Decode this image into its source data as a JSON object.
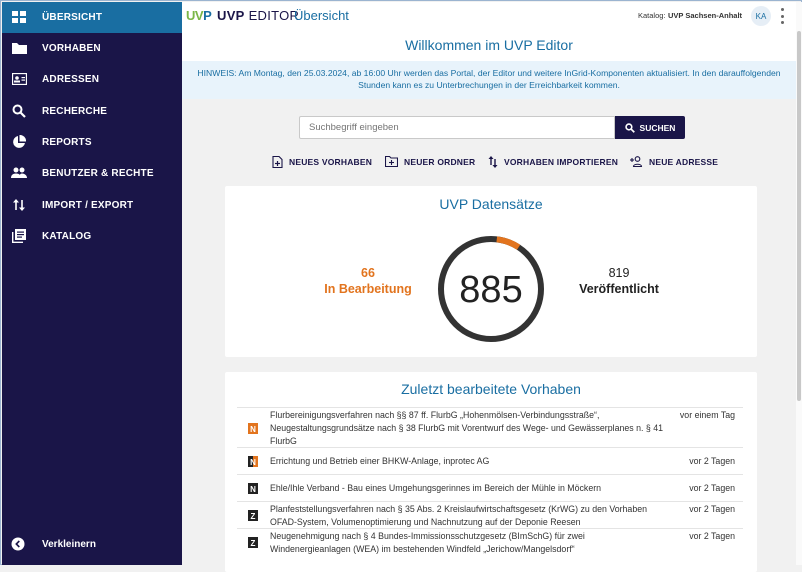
{
  "sidebar": {
    "items": [
      {
        "label": "ÜBERSICHT",
        "icon": "dashboard-icon",
        "active": true
      },
      {
        "label": "VORHABEN",
        "icon": "folder-icon"
      },
      {
        "label": "ADRESSEN",
        "icon": "contact-card-icon"
      },
      {
        "label": "RECHERCHE",
        "icon": "search-icon"
      },
      {
        "label": "REPORTS",
        "icon": "pie-chart-icon"
      },
      {
        "label": "BENUTZER & RECHTE",
        "icon": "users-icon"
      },
      {
        "label": "IMPORT / EXPORT",
        "icon": "import-export-icon"
      },
      {
        "label": "KATALOG",
        "icon": "catalog-icon"
      }
    ],
    "collapse_label": "Verkleinern"
  },
  "header": {
    "logo": "UVP",
    "app_name_bold": "UVP",
    "app_name_rest": "EDITOR",
    "page": "Übersicht",
    "catalog_label": "Katalog:",
    "catalog_value": "UVP Sachsen-Anhalt",
    "avatar": "KA"
  },
  "main": {
    "welcome": "Willkommen im UVP Editor",
    "notice": "HINWEIS: Am Montag, den 25.03.2024, ab 16:00 Uhr werden das Portal, der Editor und weitere InGrid-Komponenten aktualisiert. In den darauffolgenden Stunden kann es zu Unterbrechungen in der Erreichbarkeit kommen.",
    "search": {
      "placeholder": "Suchbegriff eingeben",
      "button": "SUCHEN"
    },
    "actions": {
      "new_project": "NEUES VORHABEN",
      "new_folder": "NEUER ORDNER",
      "import": "VORHABEN IMPORTIEREN",
      "new_address": "NEUE ADRESSE"
    },
    "stats": {
      "title": "UVP Datensätze",
      "total": "885",
      "in_progress_count": "66",
      "in_progress_label": "In Bearbeitung",
      "published_count": "819",
      "published_label": "Veröffentlicht",
      "in_progress_fraction": 0.0746,
      "colors": {
        "in_progress": "#e2741e",
        "published": "#333333"
      }
    },
    "recent": {
      "title": "Zuletzt bearbeitete Vorhaben",
      "rows": [
        {
          "text": "Flurbereinigungsverfahren nach §§ 87 ff. FlurbG „Hohenmölsen-Verbindungsstraße“, Neugestaltungsgrundsätze nach § 38 FlurbG mit Vorentwurf des Wege- und Gewässerplanes n. § 41 FlurbG",
          "time": "vor einem Tag",
          "icon": "N",
          "state": "orange"
        },
        {
          "text": "Errichtung und Betrieb einer BHKW-Anlage, inprotec AG",
          "time": "vor 2 Tagen",
          "icon": "N",
          "state": "mixed"
        },
        {
          "text": "Ehle/Ihle Verband - Bau eines Umgehungsgerinnes im Bereich der Mühle in Möckern",
          "time": "vor 2 Tagen",
          "icon": "N",
          "state": "dark"
        },
        {
          "text": "Planfeststellungsverfahren nach § 35 Abs. 2 Kreislaufwirtschaftsgesetz (KrWG) zu den Vorhaben OFAD-System, Volumenoptimierung und Nachnutzung auf der Deponie Reesen",
          "time": "vor 2 Tagen",
          "icon": "Z",
          "state": "dark"
        },
        {
          "text": "Neugenehmigung nach § 4 Bundes-Immissionsschutzgesetz (BImSchG) für zwei Windenergieanlagen (WEA) im bestehenden Windfeld „Jerichow/Mangelsdorf“",
          "time": "vor 2 Tagen",
          "icon": "Z",
          "state": "dark"
        }
      ]
    }
  }
}
